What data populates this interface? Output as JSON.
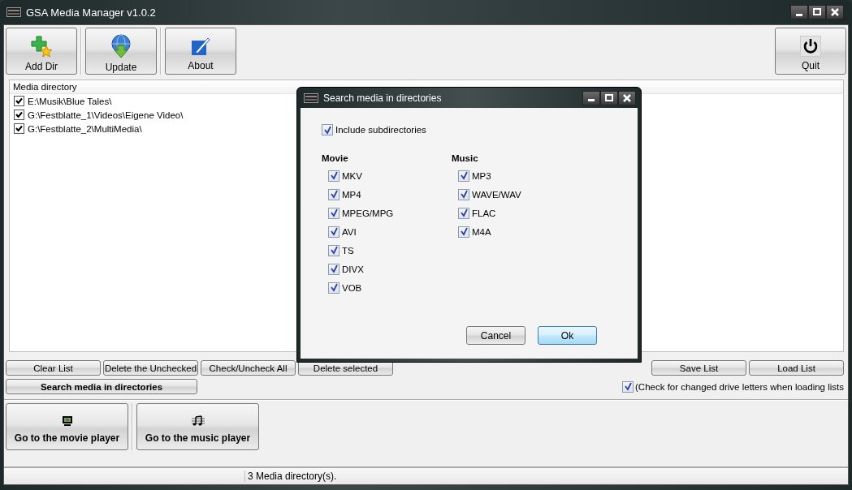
{
  "window": {
    "title": "GSA Media Manager v1.0.2"
  },
  "toolbar": [
    {
      "label": "Add Dir",
      "kind": "add"
    },
    {
      "label": "Update",
      "kind": "update"
    },
    {
      "label": "About",
      "kind": "about"
    },
    {
      "label": "Quit",
      "kind": "power"
    }
  ],
  "media_list": {
    "column_1": "Media directory",
    "items": [
      {
        "path": "E:\\Musik\\Blue Tales\\",
        "checked": true
      },
      {
        "path": "G:\\Festblatte_1\\Videos\\Eigene Video\\",
        "checked": true
      },
      {
        "path": "G:\\Festblatte_2\\MultiMedia\\",
        "checked": true
      }
    ]
  },
  "list_buttons": [
    "Clear List",
    "Delete the Unchecked",
    "Check/Uncheck All",
    "Delete selected"
  ],
  "search_button": "Search media in directories",
  "list_file_buttons": [
    "Save List",
    "Load List"
  ],
  "drive_letter_check": {
    "label": "(Check for changed drive letters when loading lists",
    "checked": true
  },
  "player_buttons": [
    {
      "label": "Go to the movie player",
      "kind": "movie"
    },
    {
      "label": "Go to the music player",
      "kind": "music"
    }
  ],
  "status_bar": "3 Media directory(s).",
  "dialog": {
    "title": "Search media in directories",
    "include_subdirectories": {
      "label": "Include subdirectories",
      "checked": true
    },
    "groups": [
      {
        "title": "Movie",
        "formats": [
          {
            "label": "MKV",
            "checked": true
          },
          {
            "label": "MP4",
            "checked": true
          },
          {
            "label": "MPEG/MPG",
            "checked": true
          },
          {
            "label": "AVI",
            "checked": true
          },
          {
            "label": "TS",
            "checked": true
          },
          {
            "label": "DIVX",
            "checked": true
          },
          {
            "label": "VOB",
            "checked": true
          }
        ]
      },
      {
        "title": "Music",
        "formats": [
          {
            "label": "MP3",
            "checked": true
          },
          {
            "label": "WAVE/WAV",
            "checked": true
          },
          {
            "label": "FLAC",
            "checked": true
          },
          {
            "label": "M4A",
            "checked": true
          }
        ]
      }
    ],
    "buttons": [
      {
        "label": "Cancel",
        "default": false
      },
      {
        "label": "Ok",
        "default": true
      }
    ]
  }
}
